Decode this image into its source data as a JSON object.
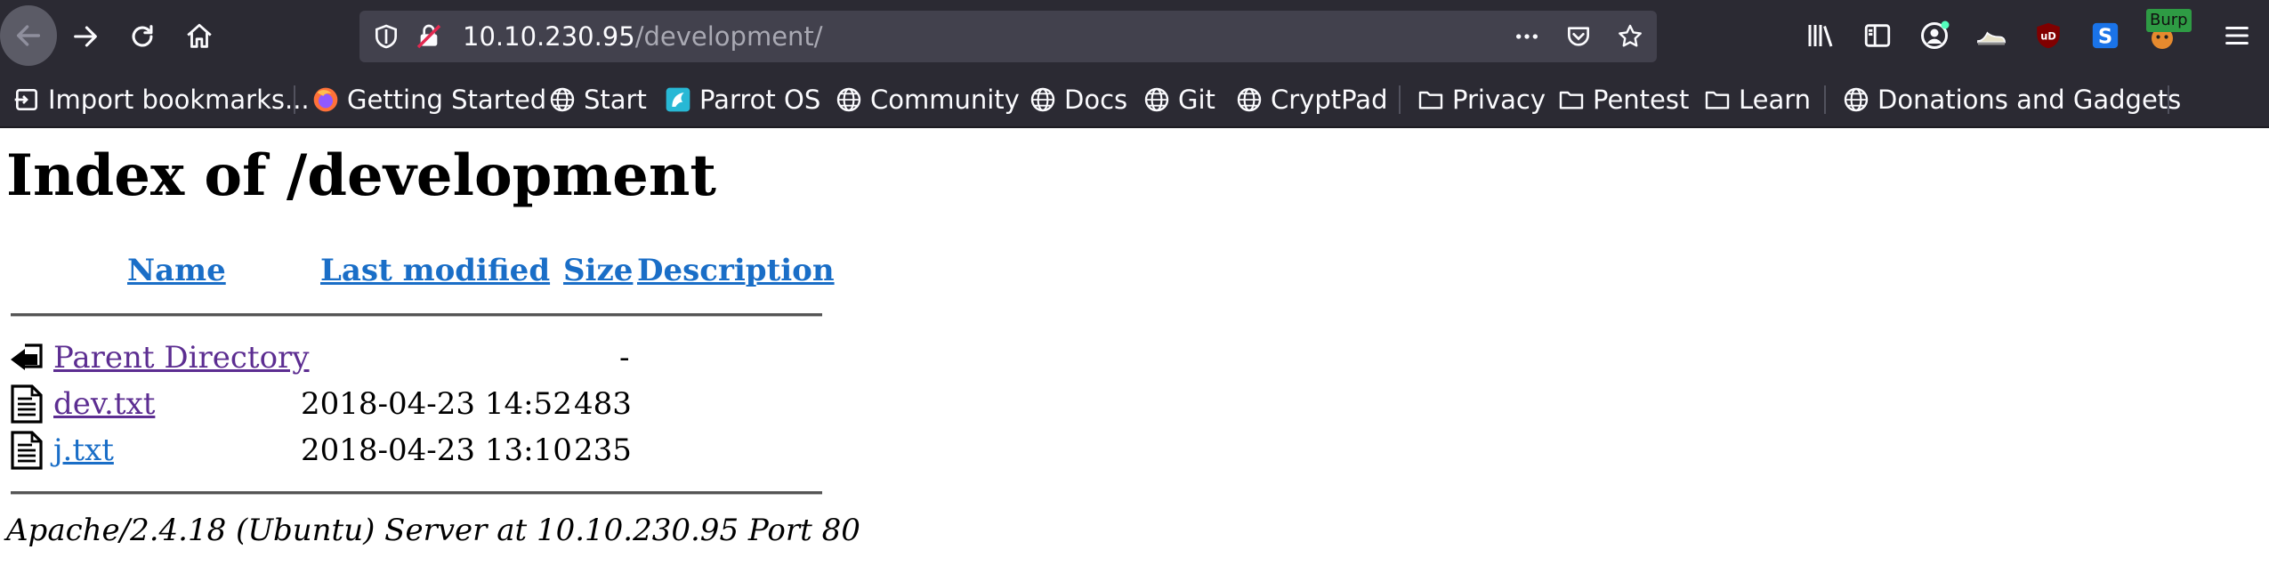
{
  "browser": {
    "url_host": "10.10.230.95",
    "url_path": "/development/",
    "burp_badge": "Burp"
  },
  "bookmarks": [
    {
      "label": "Import bookmarks...",
      "icon": "import-icon"
    },
    {
      "label": "Getting Started",
      "icon": "firefox-icon"
    },
    {
      "label": "Start",
      "icon": "globe-icon"
    },
    {
      "label": "Parrot OS",
      "icon": "parrot-icon"
    },
    {
      "label": "Community",
      "icon": "globe-icon"
    },
    {
      "label": "Docs",
      "icon": "globe-icon"
    },
    {
      "label": "Git",
      "icon": "globe-icon"
    },
    {
      "label": "CryptPad",
      "icon": "globe-icon"
    },
    {
      "label": "Privacy",
      "icon": "folder-icon"
    },
    {
      "label": "Pentest",
      "icon": "folder-icon"
    },
    {
      "label": "Learn",
      "icon": "folder-icon"
    },
    {
      "label": "Donations and Gadgets",
      "icon": "globe-icon"
    }
  ],
  "page": {
    "title": "Index of /development",
    "columns": [
      "Name",
      "Last modified",
      "Size",
      "Description"
    ],
    "rows": [
      {
        "name": "Parent Directory",
        "modified": "",
        "size": "-",
        "description": "",
        "icon": "back-folder-icon"
      },
      {
        "name": "dev.txt",
        "modified": "2018-04-23 14:52",
        "size": "483",
        "description": "",
        "icon": "text-file-icon"
      },
      {
        "name": "j.txt",
        "modified": "2018-04-23 13:10",
        "size": "235",
        "description": "",
        "icon": "text-file-icon"
      }
    ],
    "footer": "Apache/2.4.18 (Ubuntu) Server at 10.10.230.95 Port 80"
  }
}
